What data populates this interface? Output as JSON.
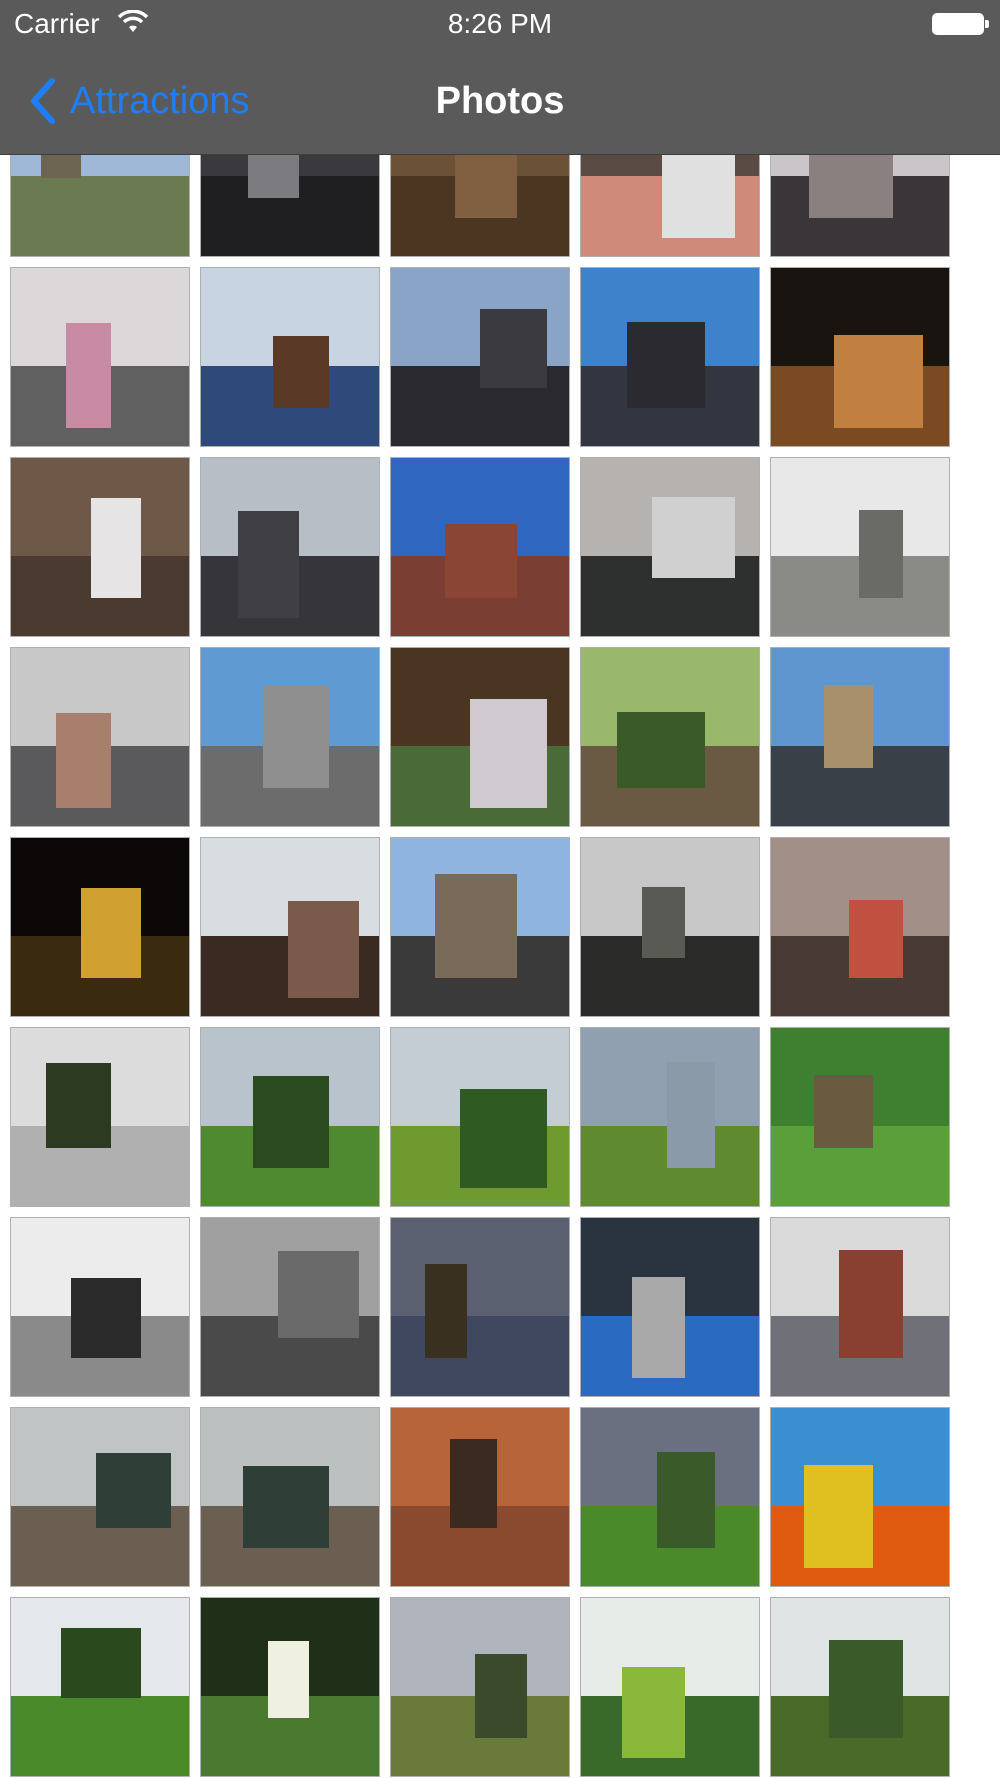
{
  "status_bar": {
    "carrier": "Carrier",
    "time": "8:26 PM"
  },
  "nav_bar": {
    "back_label": "Attractions",
    "title": "Photos"
  },
  "photos": [
    {
      "sky": "#9fb8d8",
      "ground": "#6c7a52",
      "shape": "#6e6452"
    },
    {
      "sky": "#3a3a3e",
      "ground": "#1f1f22",
      "shape": "#7b7b80"
    },
    {
      "sky": "#6b5236",
      "ground": "#4b3622",
      "shape": "#806040"
    },
    {
      "sky": "#5a4a44",
      "ground": "#d08a7a",
      "shape": "#e0e0e0"
    },
    {
      "sky": "#c9c5c8",
      "ground": "#3a3538",
      "shape": "#8a8080"
    },
    {
      "sky": "#dcd7d9",
      "ground": "#606060",
      "shape": "#c98aa4"
    },
    {
      "sky": "#c8d4e2",
      "ground": "#2e4a7a",
      "shape": "#5a3a26"
    },
    {
      "sky": "#8aa4c8",
      "ground": "#2a2a2e",
      "shape": "#3a3a40"
    },
    {
      "sky": "#3f82cc",
      "ground": "#333540",
      "shape": "#2a2a30"
    },
    {
      "sky": "#1a1410",
      "ground": "#7a4a22",
      "shape": "#c28040"
    },
    {
      "sky": "#6e5848",
      "ground": "#4a3a30",
      "shape": "#e6e4e4"
    },
    {
      "sky": "#b8bec6",
      "ground": "#35353a",
      "shape": "#3f3f44"
    },
    {
      "sky": "#2e66c0",
      "ground": "#7a3f32",
      "shape": "#8a4535"
    },
    {
      "sky": "#b6b2b0",
      "ground": "#2e3030",
      "shape": "#d0d0d0"
    },
    {
      "sky": "#e8e8e8",
      "ground": "#8a8a86",
      "shape": "#6a6a66"
    },
    {
      "sky": "#c8c8c8",
      "ground": "#5a5a5c",
      "shape": "#a87f6c"
    },
    {
      "sky": "#5f9bd2",
      "ground": "#6c6c6c",
      "shape": "#8f8f8f"
    },
    {
      "sky": "#4a3522",
      "ground": "#4a6a38",
      "shape": "#d0cad0"
    },
    {
      "sky": "#9ab86c",
      "ground": "#6a5a44",
      "shape": "#3a5a2a"
    },
    {
      "sky": "#5f96d0",
      "ground": "#3a4048",
      "shape": "#a8906a"
    },
    {
      "sky": "#0c0808",
      "ground": "#3a2a10",
      "shape": "#d0a030"
    },
    {
      "sky": "#d8dde2",
      "ground": "#3a2a22",
      "shape": "#7a5a4a"
    },
    {
      "sky": "#8fb4df",
      "ground": "#3a3a3a",
      "shape": "#7a6a5a"
    },
    {
      "sky": "#c8c8c8",
      "ground": "#2a2a28",
      "shape": "#5a5a55"
    },
    {
      "sky": "#a29088",
      "ground": "#4a3a36",
      "shape": "#c05040"
    },
    {
      "sky": "#dcdcdc",
      "ground": "#b0b0b0",
      "shape": "#2c3a22"
    },
    {
      "sky": "#b9c3cb",
      "ground": "#4f8a30",
      "shape": "#2a4a20"
    },
    {
      "sky": "#c4ccd4",
      "ground": "#6f9a30",
      "shape": "#2f5a22"
    },
    {
      "sky": "#90a0b0",
      "ground": "#5f8a30",
      "shape": "#8a9aa8"
    },
    {
      "sky": "#3f7f30",
      "ground": "#5a9f3a",
      "shape": "#6a5a40"
    },
    {
      "sky": "#ececec",
      "ground": "#8a8a8a",
      "shape": "#2a2a2a"
    },
    {
      "sky": "#a0a0a0",
      "ground": "#4a4a4a",
      "shape": "#6a6a6a"
    },
    {
      "sky": "#5a6070",
      "ground": "#404860",
      "shape": "#3a3020"
    },
    {
      "sky": "#2a3440",
      "ground": "#2a6ac0",
      "shape": "#a8a8a8"
    },
    {
      "sky": "#dadada",
      "ground": "#707078",
      "shape": "#8a4030"
    },
    {
      "sky": "#c0c4c4",
      "ground": "#6a5f50",
      "shape": "#2f3f38"
    },
    {
      "sky": "#bcc0c0",
      "ground": "#6a5f50",
      "shape": "#2f3f38"
    },
    {
      "sky": "#b8643a",
      "ground": "#8a4a30",
      "shape": "#3a2a20"
    },
    {
      "sky": "#6a7080",
      "ground": "#4a8a2a",
      "shape": "#3a5a2a"
    },
    {
      "sky": "#3a8fd0",
      "ground": "#e05a10",
      "shape": "#e0c020"
    },
    {
      "sky": "#e4e8ec",
      "ground": "#4a8a2a",
      "shape": "#2a4a1e"
    },
    {
      "sky": "#203018",
      "ground": "#4a7a30",
      "shape": "#f0f0e0"
    },
    {
      "sky": "#b0b4bc",
      "ground": "#6a7a3a",
      "shape": "#3a4a2a"
    },
    {
      "sky": "#e8ece8",
      "ground": "#3a6a2a",
      "shape": "#8ab83a"
    },
    {
      "sky": "#e0e4e4",
      "ground": "#4a6a2a",
      "shape": "#3a5a2a"
    }
  ]
}
